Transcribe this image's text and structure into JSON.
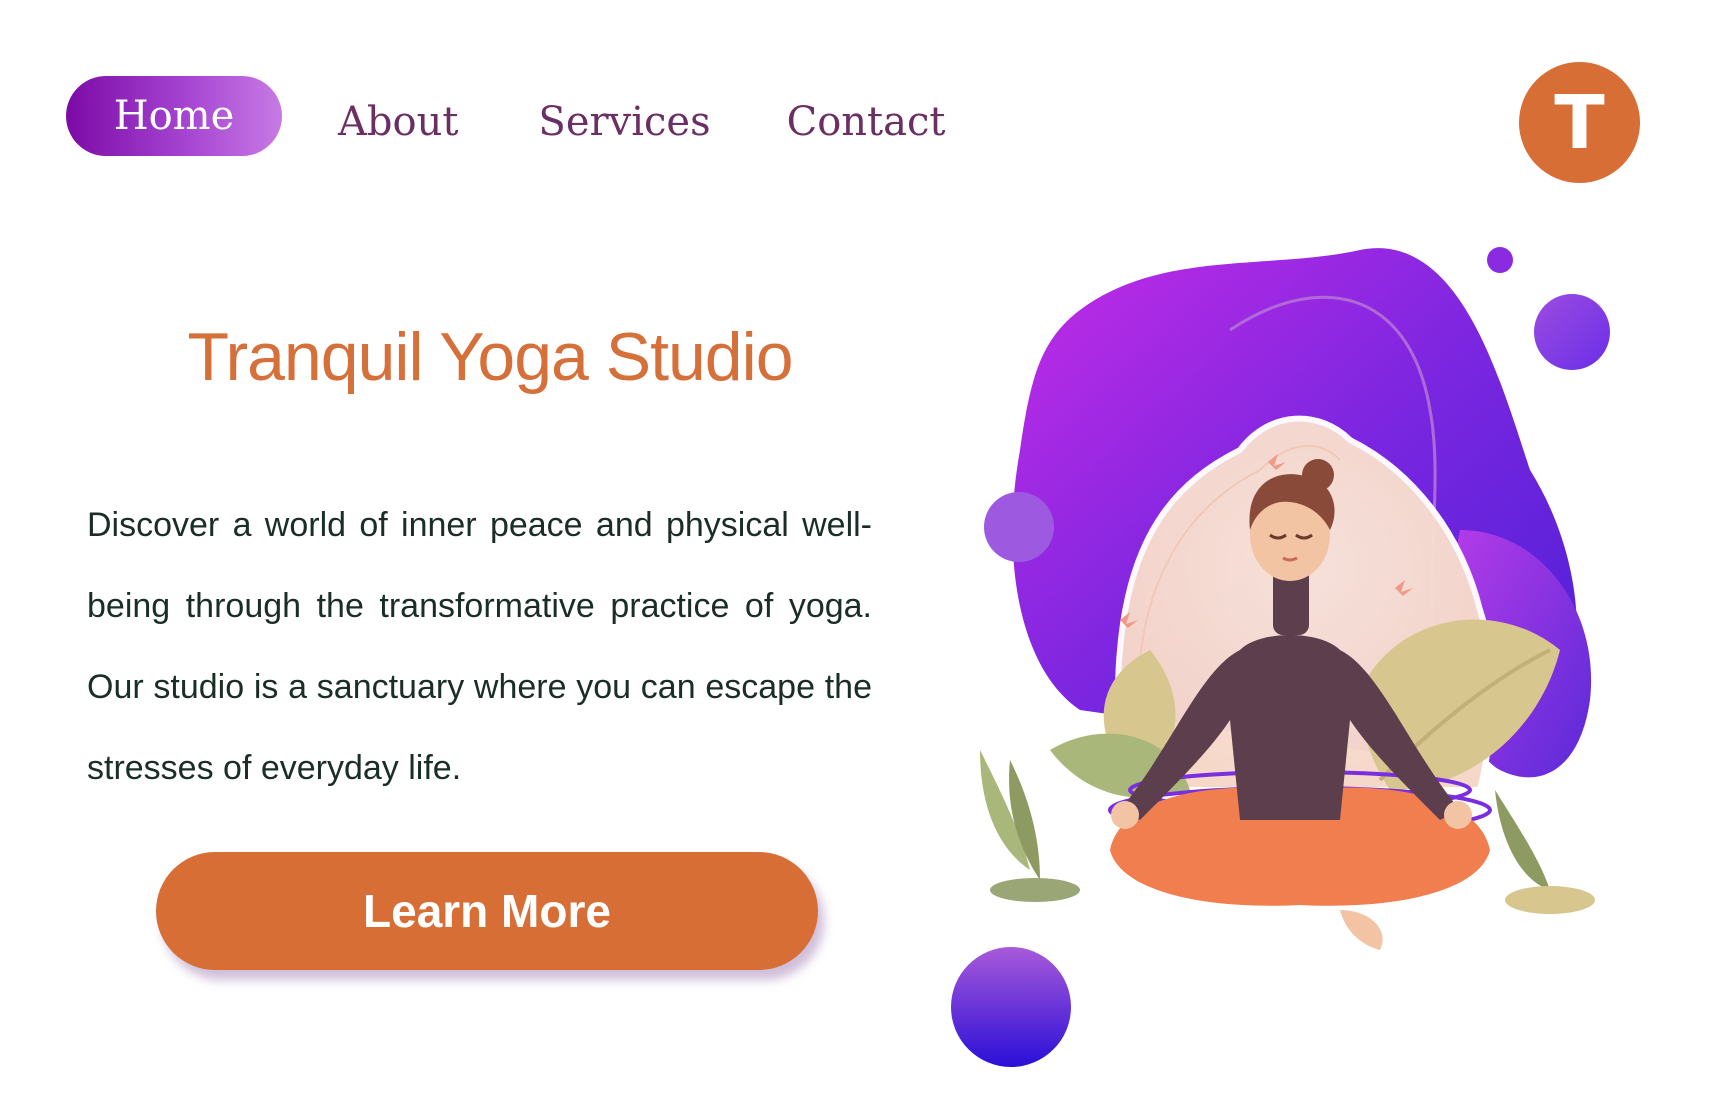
{
  "nav": {
    "items": [
      {
        "label": "Home",
        "active": true
      },
      {
        "label": "About",
        "active": false
      },
      {
        "label": "Services",
        "active": false
      },
      {
        "label": "Contact",
        "active": false
      }
    ]
  },
  "avatar": {
    "initial": "T"
  },
  "hero": {
    "title": "Tranquil Yoga Studio",
    "description": "Discover a world of inner peace and physical well-being through the transformative practice of yoga. Our studio is a sanctuary where you can escape the stresses of everyday life.",
    "button_label": "Learn More"
  },
  "colors": {
    "accent": "#d66e36",
    "nav_text": "#6b2f63",
    "active_nav_gradient_start": "#7c0aa6",
    "active_nav_gradient_end": "#c77ae4",
    "body_text": "#1b2e26"
  }
}
